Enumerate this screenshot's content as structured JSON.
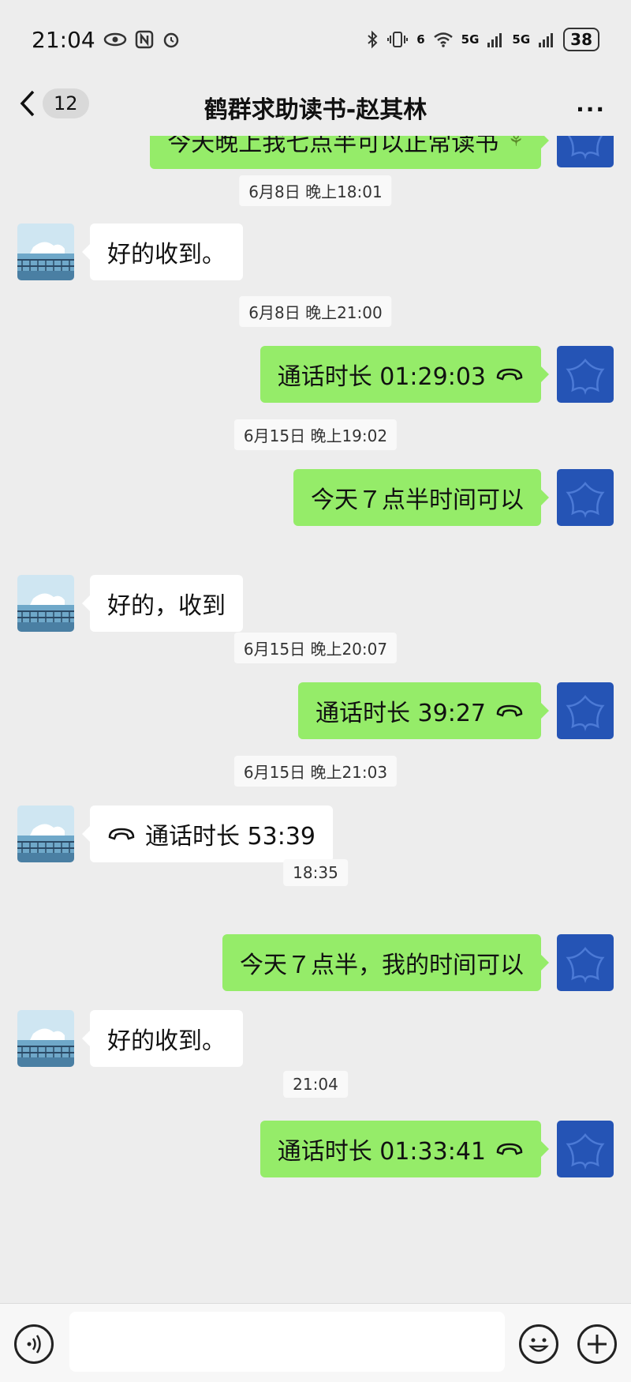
{
  "status_bar": {
    "time": "21:04",
    "battery": "38",
    "network_labels": [
      "6",
      "5G",
      "5G"
    ]
  },
  "header": {
    "unread_count": "12",
    "title": "鹤群求助读书-赵其林",
    "more_label": "···"
  },
  "messages": {
    "top_partial": "今天晚上我七点半可以正常读书",
    "t1": "6月8日 晚上18:01",
    "m1": "好的收到。",
    "t2": "6月8日 晚上21:00",
    "m2": "通话时长 01:29:03",
    "t3": "6月15日 晚上19:02",
    "m3": "今天７点半时间可以",
    "m4": "好的，收到",
    "t4": "6月15日 晚上20:07",
    "m5": "通话时长 39:27",
    "t5": "6月15日 晚上21:03",
    "m6": "通话时长 53:39",
    "t6": "18:35",
    "m7": "今天７点半，我的时间可以",
    "m8": "好的收到。",
    "t7": "21:04",
    "m9": "通话时长 01:33:41"
  },
  "colors": {
    "outgoing_bubble": "#95EC69",
    "incoming_bubble": "#FFFFFF",
    "background": "#EDEDED",
    "own_avatar": "#2554B5"
  },
  "icons": {
    "back": "chevron-left-icon",
    "more": "more-dots-icon",
    "call": "phone-hangup-icon",
    "voice": "voice-icon",
    "emoji": "emoji-icon",
    "plus": "plus-icon"
  }
}
